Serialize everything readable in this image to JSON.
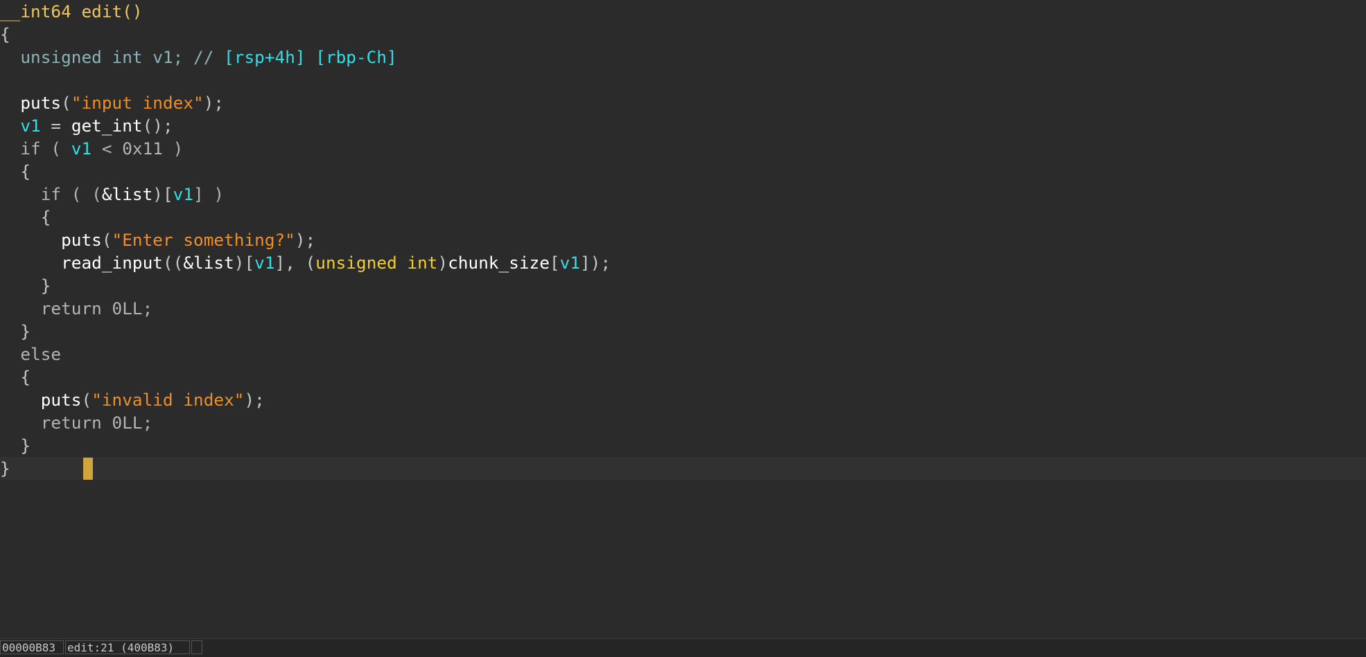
{
  "code": {
    "lines": [
      [
        {
          "t": "__int64 edit()",
          "c": "tok-fn-decl"
        }
      ],
      [
        {
          "t": "{",
          "c": "tok-punc"
        }
      ],
      [
        {
          "t": "  ",
          "c": "tok-punc"
        },
        {
          "t": "unsigned int v1",
          "c": "tok-type-dim"
        },
        {
          "t": "; // ",
          "c": "tok-comment"
        },
        {
          "t": "[rsp+4h] [rbp-Ch]",
          "c": "tok-reg"
        }
      ],
      [
        {
          "t": "",
          "c": "tok-punc"
        }
      ],
      [
        {
          "t": "  ",
          "c": "tok-punc"
        },
        {
          "t": "puts",
          "c": "tok-fn"
        },
        {
          "t": "(",
          "c": "tok-punc"
        },
        {
          "t": "\"input index\"",
          "c": "tok-str"
        },
        {
          "t": ");",
          "c": "tok-punc"
        }
      ],
      [
        {
          "t": "  ",
          "c": "tok-punc"
        },
        {
          "t": "v1",
          "c": "tok-var"
        },
        {
          "t": " = ",
          "c": "tok-punc"
        },
        {
          "t": "get_int",
          "c": "tok-fn"
        },
        {
          "t": "();",
          "c": "tok-punc"
        }
      ],
      [
        {
          "t": "  if ( ",
          "c": "tok-kw"
        },
        {
          "t": "v1",
          "c": "tok-var"
        },
        {
          "t": " < 0x11 )",
          "c": "tok-kw"
        }
      ],
      [
        {
          "t": "  {",
          "c": "tok-punc"
        }
      ],
      [
        {
          "t": "    if ( (",
          "c": "tok-kw"
        },
        {
          "t": "&list",
          "c": "tok-fn"
        },
        {
          "t": ")[",
          "c": "tok-punc"
        },
        {
          "t": "v1",
          "c": "tok-var"
        },
        {
          "t": "] )",
          "c": "tok-kw"
        }
      ],
      [
        {
          "t": "    {",
          "c": "tok-punc"
        }
      ],
      [
        {
          "t": "      ",
          "c": "tok-punc"
        },
        {
          "t": "puts",
          "c": "tok-fn"
        },
        {
          "t": "(",
          "c": "tok-punc"
        },
        {
          "t": "\"Enter something?\"",
          "c": "tok-str"
        },
        {
          "t": ");",
          "c": "tok-punc"
        }
      ],
      [
        {
          "t": "      ",
          "c": "tok-punc"
        },
        {
          "t": "read_input",
          "c": "tok-fn"
        },
        {
          "t": "((",
          "c": "tok-punc"
        },
        {
          "t": "&list",
          "c": "tok-fn"
        },
        {
          "t": ")[",
          "c": "tok-punc"
        },
        {
          "t": "v1",
          "c": "tok-var"
        },
        {
          "t": "], (",
          "c": "tok-punc"
        },
        {
          "t": "unsigned int",
          "c": "tok-type"
        },
        {
          "t": ")",
          "c": "tok-punc"
        },
        {
          "t": "chunk_size",
          "c": "tok-fn"
        },
        {
          "t": "[",
          "c": "tok-punc"
        },
        {
          "t": "v1",
          "c": "tok-var"
        },
        {
          "t": "]);",
          "c": "tok-punc"
        }
      ],
      [
        {
          "t": "    }",
          "c": "tok-punc"
        }
      ],
      [
        {
          "t": "    return 0LL;",
          "c": "tok-kw"
        }
      ],
      [
        {
          "t": "  }",
          "c": "tok-punc"
        }
      ],
      [
        {
          "t": "  else",
          "c": "tok-kw"
        }
      ],
      [
        {
          "t": "  {",
          "c": "tok-punc"
        }
      ],
      [
        {
          "t": "    ",
          "c": "tok-punc"
        },
        {
          "t": "puts",
          "c": "tok-fn"
        },
        {
          "t": "(",
          "c": "tok-punc"
        },
        {
          "t": "\"invalid index\"",
          "c": "tok-str"
        },
        {
          "t": ");",
          "c": "tok-punc"
        }
      ],
      [
        {
          "t": "    return 0LL;",
          "c": "tok-kw"
        }
      ],
      [
        {
          "t": "  }",
          "c": "tok-punc"
        }
      ],
      [
        {
          "t": "}",
          "c": "tok-punc"
        }
      ]
    ],
    "current_line": 21
  },
  "status": {
    "address": "00000B83",
    "location": "edit:21 (400B83)",
    "extra": ""
  },
  "colors": {
    "background": "#2b2b2b",
    "caret": "#d0a53b",
    "string": "#f08f23",
    "variable": "#2ee0e8",
    "type": "#f5cf2b",
    "function_decl": "#f0c660"
  }
}
